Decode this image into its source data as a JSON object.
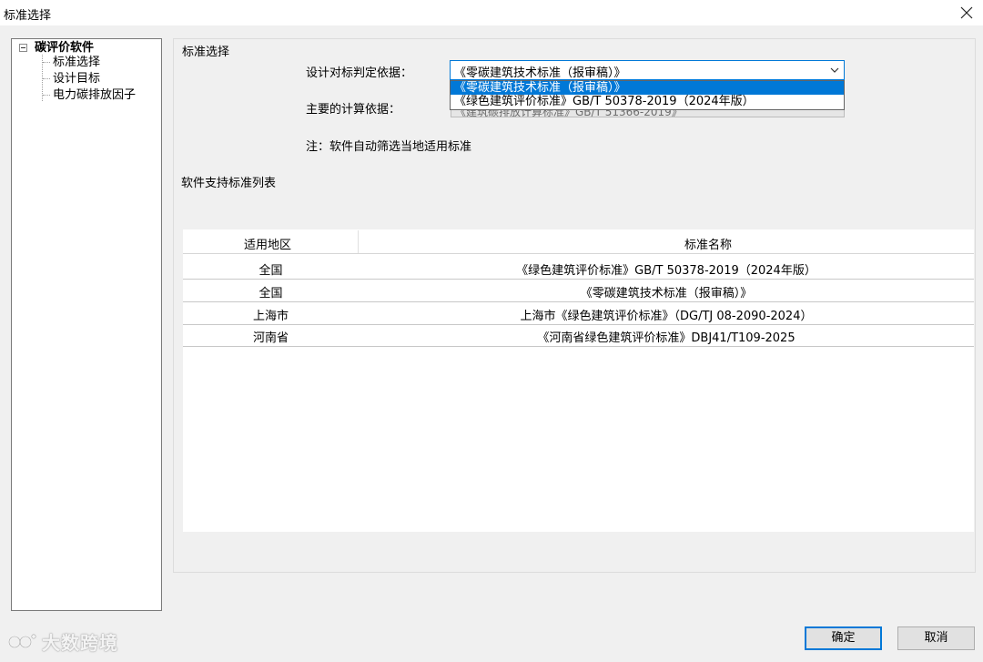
{
  "window": {
    "title": "标准选择"
  },
  "tree": {
    "root": "碳评价软件",
    "children": [
      "标准选择",
      "设计目标",
      "电力碳排放因子"
    ]
  },
  "panel": {
    "group_title": "标准选择",
    "design_label": "设计对标判定依据：",
    "design_value": "《零碳建筑技术标准（报审稿）》",
    "dropdown_options": [
      "《零碳建筑技术标准（报审稿）》",
      "《绿色建筑评价标准》GB/T 50378-2019（2024年版）"
    ],
    "calc_label": "主要的计算依据：",
    "calc_value": "《建筑碳排放计算标准》GB/T 51366-2019》",
    "note": "注：软件自动筛选当地适用标准",
    "list_title": "软件支持标准列表"
  },
  "table": {
    "headers": [
      "适用地区",
      "标准名称"
    ],
    "rows": [
      [
        "全国",
        "《绿色建筑评价标准》GB/T 50378-2019（2024年版）"
      ],
      [
        "全国",
        "《零碳建筑技术标准（报审稿）》"
      ],
      [
        "上海市",
        "上海市《绿色建筑评价标准》（DG/TJ 08-2090-2024）"
      ],
      [
        "河南省",
        "《河南省绿色建筑评价标准》DBJ41/T109-2025"
      ]
    ]
  },
  "buttons": {
    "ok": "确定",
    "cancel": "取消"
  },
  "watermark": {
    "text": "大数跨境"
  },
  "icons": {
    "close": "close-icon",
    "combo_arrow": "chevron-down-icon",
    "tree_toggle": "tree-collapse-icon"
  },
  "colors": {
    "selection": "#0078d7",
    "window_bg": "#f0f0f0"
  }
}
